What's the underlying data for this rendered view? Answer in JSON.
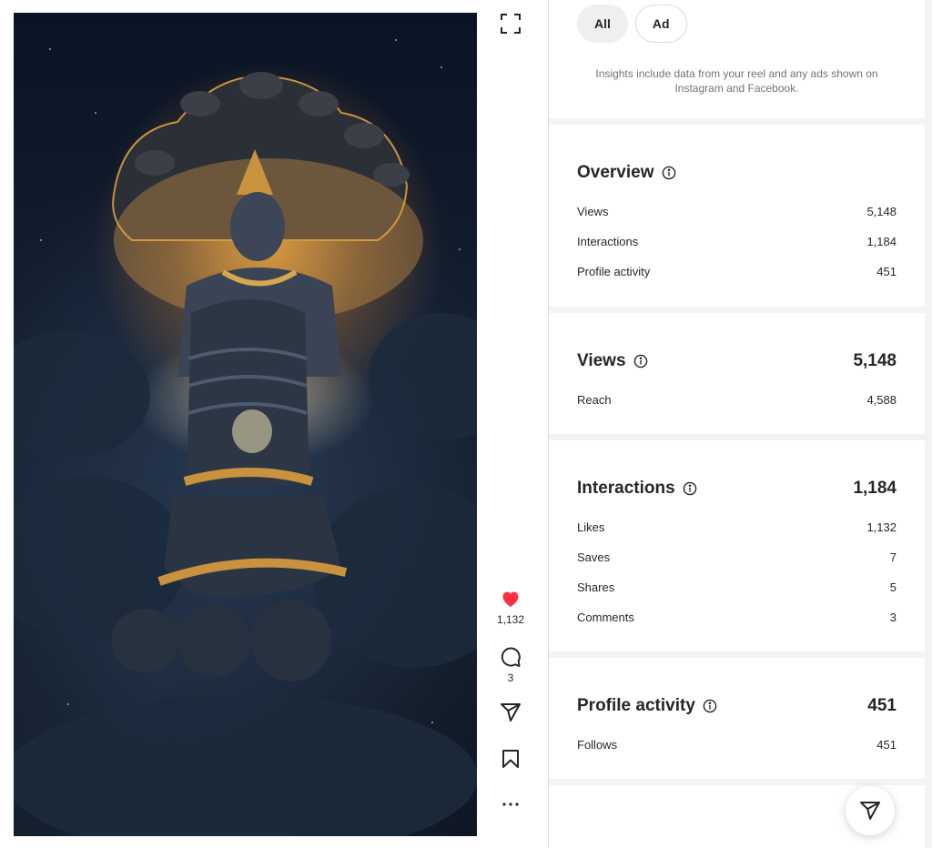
{
  "filters": {
    "all_label": "All",
    "ad_label": "Ad"
  },
  "note": "Insights include data from your reel and any ads shown on Instagram and Facebook.",
  "actions": {
    "likes_count": "1,132",
    "comments_count": "3"
  },
  "overview": {
    "title": "Overview",
    "rows": [
      {
        "label": "Views",
        "value": "5,148"
      },
      {
        "label": "Interactions",
        "value": "1,184"
      },
      {
        "label": "Profile activity",
        "value": "451"
      }
    ]
  },
  "views": {
    "title": "Views",
    "total": "5,148",
    "rows": [
      {
        "label": "Reach",
        "value": "4,588"
      }
    ]
  },
  "interactions": {
    "title": "Interactions",
    "total": "1,184",
    "rows": [
      {
        "label": "Likes",
        "value": "1,132"
      },
      {
        "label": "Saves",
        "value": "7"
      },
      {
        "label": "Shares",
        "value": "5"
      },
      {
        "label": "Comments",
        "value": "3"
      }
    ]
  },
  "profile_activity": {
    "title": "Profile activity",
    "total": "451",
    "rows": [
      {
        "label": "Follows",
        "value": "451"
      }
    ]
  },
  "colors": {
    "like_red": "#ff3040",
    "text": "#262626",
    "muted": "#737373",
    "panel_bg": "#f3f3f3"
  },
  "icons": [
    "expand-icon",
    "heart-icon",
    "comment-icon",
    "share-icon",
    "bookmark-icon",
    "more-icon",
    "info-icon",
    "send-icon"
  ]
}
